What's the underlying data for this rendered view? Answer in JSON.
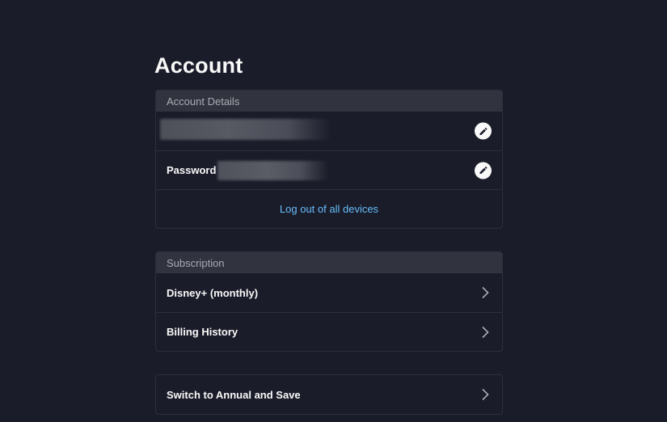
{
  "page": {
    "title": "Account"
  },
  "account_details": {
    "header": "Account Details",
    "password_label": "Password",
    "logout_link": "Log out of all devices"
  },
  "subscription": {
    "header": "Subscription",
    "items": [
      {
        "label": "Disney+ (monthly)"
      },
      {
        "label": "Billing History"
      }
    ]
  },
  "promo": {
    "label": "Switch to Annual and Save"
  },
  "icons": {
    "edit": "pencil-icon",
    "chevron": "chevron-right-icon"
  },
  "colors": {
    "background": "#1a1c29",
    "card_header": "#31343e",
    "link": "#67bdfc",
    "text": "#f9f9f9"
  }
}
